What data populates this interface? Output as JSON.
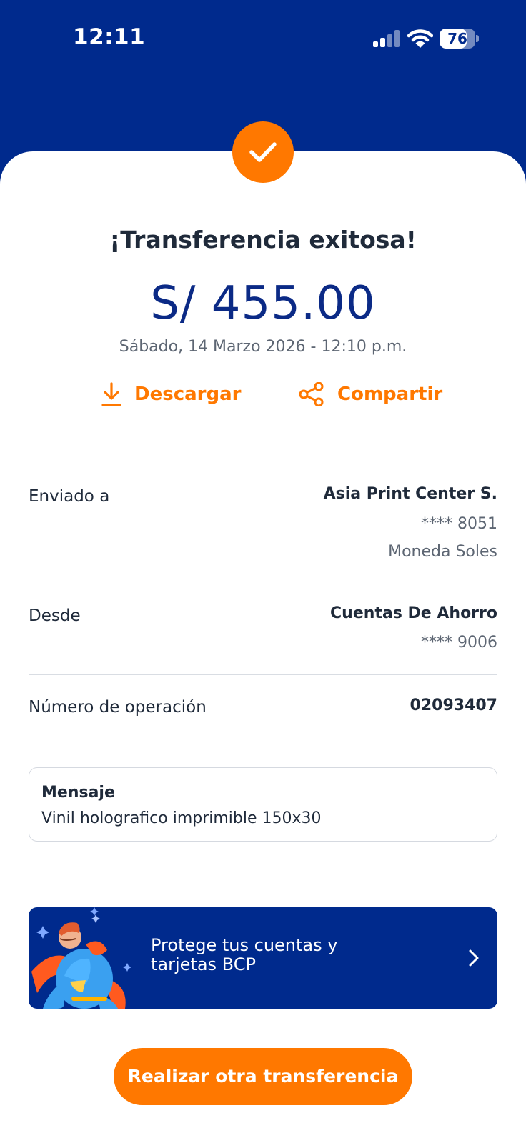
{
  "status_bar": {
    "time": "12:11",
    "battery_level": "76",
    "battery_fraction": 0.76
  },
  "header": {
    "title": "¡Transferencia exitosa!",
    "amount": "S/ 455.00",
    "datetime": "Sábado, 14 Marzo 2026 - 12:10 p.m."
  },
  "actions": {
    "download_label": "Descargar",
    "share_label": "Compartir"
  },
  "details": {
    "sent_to": {
      "label": "Enviado a",
      "name": "Asia Print Center S.",
      "account": "**** 8051",
      "currency": "Moneda Soles"
    },
    "from": {
      "label": "Desde",
      "account_name": "Cuentas De Ahorro",
      "account": "**** 9006"
    },
    "operation": {
      "label": "Número de operación",
      "number": "02093407"
    }
  },
  "message": {
    "title": "Mensaje",
    "text": "Vinil holografico imprimible 150x30"
  },
  "promo": {
    "line1": "Protege tus cuentas y",
    "line2": "tarjetas BCP"
  },
  "cta": {
    "label": "Realizar otra transferencia"
  },
  "colors": {
    "brand_blue": "#002a8d",
    "accent_orange": "#ff7800",
    "text_dark": "#1f2a3a",
    "text_muted": "#5d6673"
  },
  "icons": [
    "check-icon",
    "download-icon",
    "share-icon",
    "chevron-right-icon",
    "signal-icon",
    "wifi-icon",
    "battery-icon"
  ]
}
